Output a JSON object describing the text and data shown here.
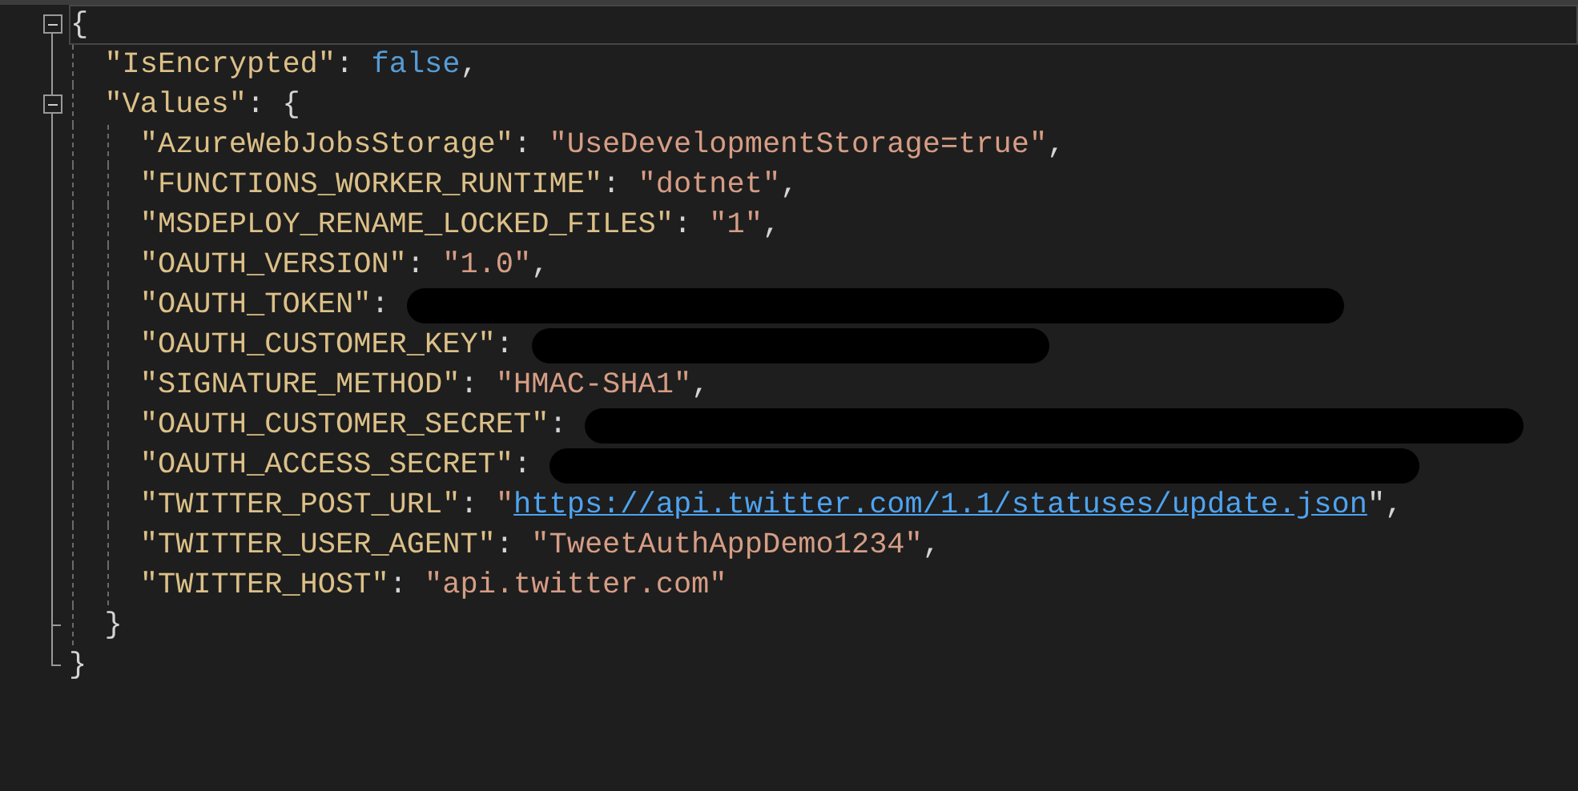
{
  "editor": {
    "root": {
      "open": "{",
      "expanded": true,
      "close": "}",
      "children": [
        {
          "kind": "keyword",
          "key": "\"IsEncrypted\"",
          "sep": ":",
          "value": "false",
          "trail": ","
        },
        {
          "kind": "object",
          "key": "\"Values\"",
          "sep": ":",
          "open": "{",
          "expanded": true,
          "close": "}",
          "children": [
            {
              "kind": "string",
              "key": "\"AzureWebJobsStorage\"",
              "sep": ":",
              "value": "\"UseDevelopmentStorage=true\"",
              "trail": ","
            },
            {
              "kind": "string",
              "key": "\"FUNCTIONS_WORKER_RUNTIME\"",
              "sep": ":",
              "value": "\"dotnet\"",
              "trail": ","
            },
            {
              "kind": "string",
              "key": "\"MSDEPLOY_RENAME_LOCKED_FILES\"",
              "sep": ":",
              "value": "\"1\"",
              "trail": ","
            },
            {
              "kind": "string",
              "key": "\"OAUTH_VERSION\"",
              "sep": ":",
              "value": "\"1.0\"",
              "trail": ","
            },
            {
              "kind": "redacted",
              "key": "\"OAUTH_TOKEN\"",
              "sep": ":"
            },
            {
              "kind": "redacted",
              "key": "\"OAUTH_CUSTOMER_KEY\"",
              "sep": ":"
            },
            {
              "kind": "string",
              "key": "\"SIGNATURE_METHOD\"",
              "sep": ":",
              "value": "\"HMAC-SHA1\"",
              "trail": ","
            },
            {
              "kind": "redacted",
              "key": "\"OAUTH_CUSTOMER_SECRET\"",
              "sep": ":"
            },
            {
              "kind": "redacted",
              "key": "\"OAUTH_ACCESS_SECRET\"",
              "sep": ":"
            },
            {
              "kind": "link",
              "key": "\"TWITTER_POST_URL\"",
              "sep": ":",
              "quote": "\"",
              "value": "https://api.twitter.com/1.1/statuses/update.json",
              "trail": "\","
            },
            {
              "kind": "string",
              "key": "\"TWITTER_USER_AGENT\"",
              "sep": ":",
              "value": "\"TweetAuthAppDemo1234\"",
              "trail": ","
            },
            {
              "kind": "string",
              "key": "\"TWITTER_HOST\"",
              "sep": ":",
              "value": "\"api.twitter.com\""
            }
          ]
        }
      ]
    }
  }
}
